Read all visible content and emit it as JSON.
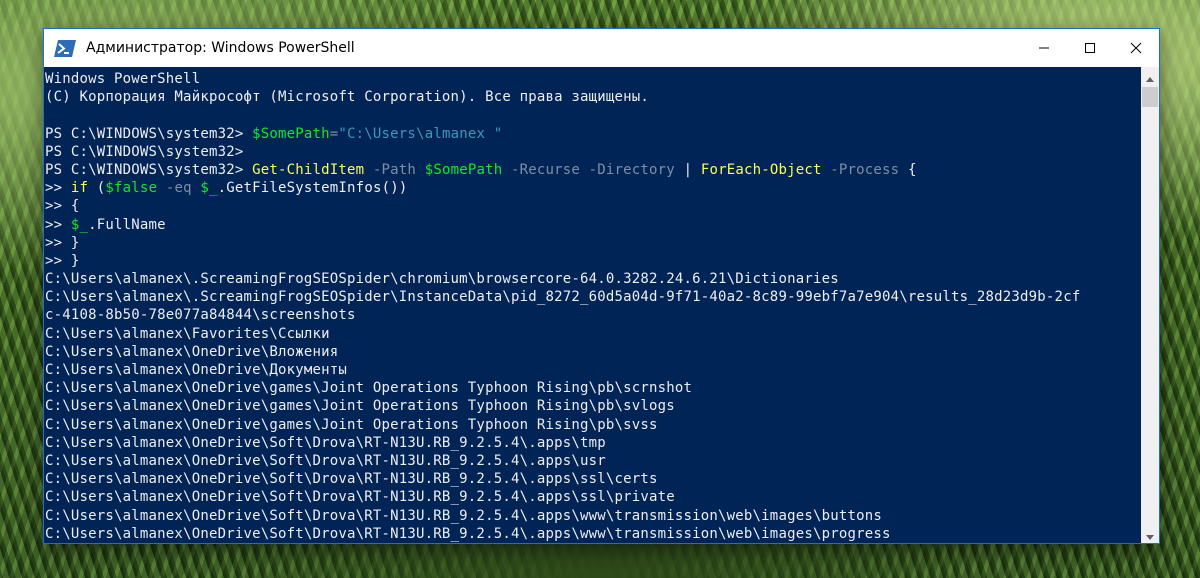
{
  "window": {
    "title": "Администратор: Windows PowerShell"
  },
  "console": {
    "lines": [
      [
        {
          "t": "Windows PowerShell",
          "c": ""
        }
      ],
      [
        {
          "t": "(С) Корпорация Майкрософт (Microsoft Corporation). Все права защищены.",
          "c": ""
        }
      ],
      [
        {
          "t": "",
          "c": ""
        }
      ],
      [
        {
          "t": "PS C:\\WINDOWS\\system32> ",
          "c": ""
        },
        {
          "t": "$SomePath",
          "c": "var"
        },
        {
          "t": "=",
          "c": "param"
        },
        {
          "t": "\"C:\\Users\\almanex \"",
          "c": "str"
        }
      ],
      [
        {
          "t": "PS C:\\WINDOWS\\system32>",
          "c": ""
        }
      ],
      [
        {
          "t": "PS C:\\WINDOWS\\system32> ",
          "c": ""
        },
        {
          "t": "Get-ChildItem",
          "c": "yellow"
        },
        {
          "t": " -Path ",
          "c": "param"
        },
        {
          "t": "$SomePath",
          "c": "var"
        },
        {
          "t": " -Recurse -Directory ",
          "c": "param"
        },
        {
          "t": "| ",
          "c": ""
        },
        {
          "t": "ForEach-Object",
          "c": "yellow"
        },
        {
          "t": " -Process ",
          "c": "param"
        },
        {
          "t": "{",
          "c": ""
        }
      ],
      [
        {
          "t": ">> ",
          "c": ""
        },
        {
          "t": "if",
          "c": "yellow"
        },
        {
          "t": " (",
          "c": ""
        },
        {
          "t": "$false",
          "c": "var"
        },
        {
          "t": " -eq ",
          "c": "param"
        },
        {
          "t": "$_",
          "c": "var"
        },
        {
          "t": ".GetFileSystemInfos())",
          "c": ""
        }
      ],
      [
        {
          "t": ">> {",
          "c": ""
        }
      ],
      [
        {
          "t": ">> ",
          "c": ""
        },
        {
          "t": "$_",
          "c": "var"
        },
        {
          "t": ".FullName",
          "c": ""
        }
      ],
      [
        {
          "t": ">> }",
          "c": ""
        }
      ],
      [
        {
          "t": ">> }",
          "c": ""
        }
      ],
      [
        {
          "t": "C:\\Users\\almanex\\.ScreamingFrogSEOSpider\\chromium\\browsercore-64.0.3282.24.6.21\\Dictionaries",
          "c": ""
        }
      ],
      [
        {
          "t": "C:\\Users\\almanex\\.ScreamingFrogSEOSpider\\InstanceData\\pid_8272_60d5a04d-9f71-40a2-8c89-99ebf7a7e904\\results_28d23d9b-2cf",
          "c": ""
        }
      ],
      [
        {
          "t": "c-4108-8b50-78e077a84844\\screenshots",
          "c": ""
        }
      ],
      [
        {
          "t": "C:\\Users\\almanex\\Favorites\\Ссылки",
          "c": ""
        }
      ],
      [
        {
          "t": "C:\\Users\\almanex\\OneDrive\\Вложения",
          "c": ""
        }
      ],
      [
        {
          "t": "C:\\Users\\almanex\\OneDrive\\Документы",
          "c": ""
        }
      ],
      [
        {
          "t": "C:\\Users\\almanex\\OneDrive\\games\\Joint Operations Typhoon Rising\\pb\\scrnshot",
          "c": ""
        }
      ],
      [
        {
          "t": "C:\\Users\\almanex\\OneDrive\\games\\Joint Operations Typhoon Rising\\pb\\svlogs",
          "c": ""
        }
      ],
      [
        {
          "t": "C:\\Users\\almanex\\OneDrive\\games\\Joint Operations Typhoon Rising\\pb\\svss",
          "c": ""
        }
      ],
      [
        {
          "t": "C:\\Users\\almanex\\OneDrive\\Soft\\Drova\\RT-N13U.RB_9.2.5.4\\.apps\\tmp",
          "c": ""
        }
      ],
      [
        {
          "t": "C:\\Users\\almanex\\OneDrive\\Soft\\Drova\\RT-N13U.RB_9.2.5.4\\.apps\\usr",
          "c": ""
        }
      ],
      [
        {
          "t": "C:\\Users\\almanex\\OneDrive\\Soft\\Drova\\RT-N13U.RB_9.2.5.4\\.apps\\ssl\\certs",
          "c": ""
        }
      ],
      [
        {
          "t": "C:\\Users\\almanex\\OneDrive\\Soft\\Drova\\RT-N13U.RB_9.2.5.4\\.apps\\ssl\\private",
          "c": ""
        }
      ],
      [
        {
          "t": "C:\\Users\\almanex\\OneDrive\\Soft\\Drova\\RT-N13U.RB_9.2.5.4\\.apps\\www\\transmission\\web\\images\\buttons",
          "c": ""
        }
      ],
      [
        {
          "t": "C:\\Users\\almanex\\OneDrive\\Soft\\Drova\\RT-N13U.RB_9.2.5.4\\.apps\\www\\transmission\\web\\images\\progress",
          "c": ""
        }
      ]
    ]
  },
  "colors": {
    "console_bg": "#012456",
    "text": "#eeedf0",
    "variable": "#12e826",
    "command": "#fdfd56",
    "string": "#3a9ab5",
    "parameter": "#7f8ea3"
  },
  "icons": {
    "app": "powershell-icon",
    "minimize": "minimize-icon",
    "maximize": "maximize-icon",
    "close": "close-icon"
  }
}
